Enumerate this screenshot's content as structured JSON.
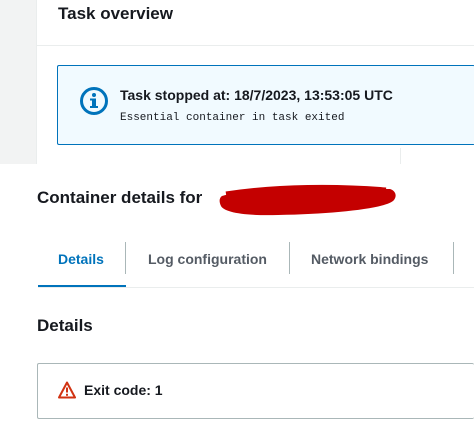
{
  "task_overview": {
    "title": "Task overview",
    "alert": {
      "icon": "info-icon",
      "title": "Task stopped at: 18/7/2023, 13:53:05 UTC",
      "subtitle": "Essential container in task exited",
      "color": "#0073bb"
    }
  },
  "container_details": {
    "title": "Container details for",
    "redacted": true,
    "tabs": [
      {
        "label": "Details",
        "active": true
      },
      {
        "label": "Log configuration",
        "active": false
      },
      {
        "label": "Network bindings",
        "active": false
      }
    ],
    "details_heading": "Details",
    "exit": {
      "icon": "warning-icon",
      "label": "Exit code: 1",
      "color": "#d13212"
    }
  }
}
